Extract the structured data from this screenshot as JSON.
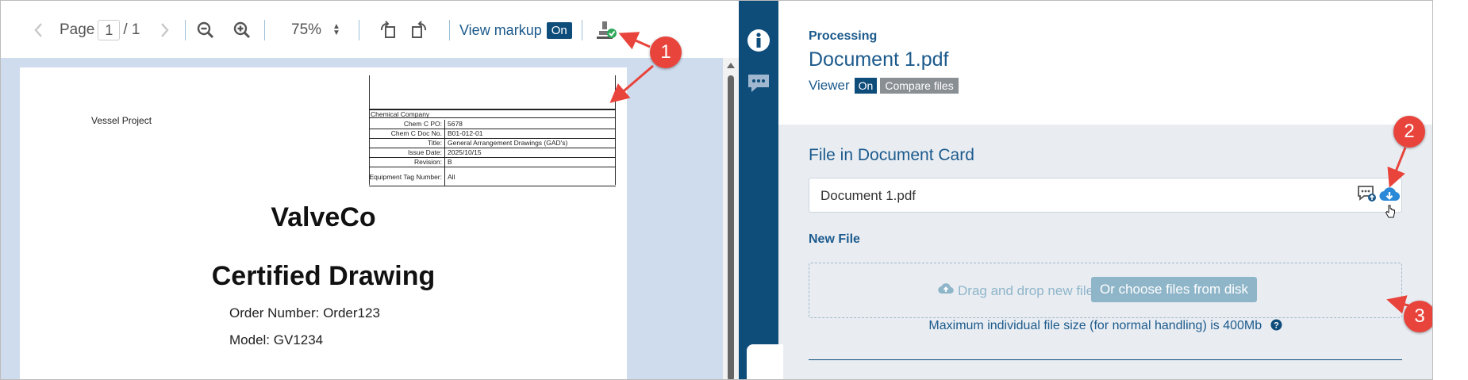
{
  "toolbar": {
    "page_label": "Page",
    "page_current": "1",
    "page_total": "/ 1",
    "zoom_value": "75%",
    "view_markup_label": "View markup",
    "view_markup_state": "On"
  },
  "document": {
    "project": "Vessel Project",
    "title_block": {
      "header": "Chemical Company",
      "rows": [
        {
          "key": "Chem C PO:",
          "value": "5678"
        },
        {
          "key": "Chem C Doc No.",
          "value": "B01-012-01"
        },
        {
          "key": "Title:",
          "value": "General Arrangement Drawings (GAD's)"
        },
        {
          "key": "Issue Date:",
          "value": "2025/10/15"
        },
        {
          "key": "Revision:",
          "value": "B"
        },
        {
          "key": "Equipment Tag Number:",
          "value": "All"
        }
      ]
    },
    "company": "ValveCo",
    "heading": "Certified Drawing",
    "order_number": "Order Number: Order123",
    "model": "Model: GV1234"
  },
  "panel": {
    "status": "Processing",
    "doc_title": "Document 1.pdf",
    "viewer_label": "Viewer",
    "viewer_state": "On",
    "compare_label": "Compare files",
    "file_section_title": "File in Document Card",
    "file_name": "Document 1.pdf",
    "new_file_label": "New File",
    "drag_drop_text": "Drag and drop new file",
    "choose_files_button": "Or choose files from disk",
    "max_size_text": "Maximum individual file size (for normal handling) is 400Mb"
  },
  "callouts": [
    "1",
    "2",
    "3"
  ],
  "colors": {
    "brand_dark": "#0e4c7a",
    "brand_link": "#1c5a8c",
    "callout_red": "#e8443c",
    "panel_bg": "#e9edf2"
  },
  "icons": [
    "chevron-left-icon",
    "chevron-right-icon",
    "zoom-out-icon",
    "zoom-in-icon",
    "rotate-left-icon",
    "rotate-right-icon",
    "stamp-check-icon",
    "info-icon",
    "comments-icon",
    "card-upload-icon",
    "cloud-download-icon",
    "cloud-upload-icon",
    "help-icon"
  ]
}
